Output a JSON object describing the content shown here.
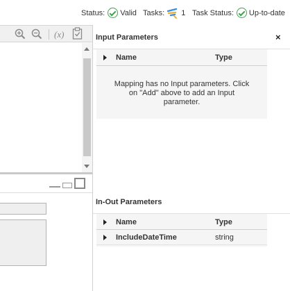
{
  "status_bar": {
    "status_label": "Status:",
    "status_value": "Valid",
    "tasks_label": "Tasks:",
    "tasks_count": "1",
    "task_status_label": "Task Status:",
    "task_status_value": "Up-to-date",
    "check_color": "#3fa34d"
  },
  "toolbar": {
    "zoom_in_icon": "zoom-in-icon",
    "zoom_out_icon": "zoom-out-icon",
    "expression_label": "(x)",
    "validate_icon": "clipboard-check-icon"
  },
  "input_parameters": {
    "title": "Input Parameters",
    "close_label": "×",
    "columns": [
      "Name",
      "Type"
    ],
    "empty_message": "Mapping has no Input parameters. Click on \"Add\" above to add an Input parameter."
  },
  "inout_parameters": {
    "title": "In-Out Parameters",
    "columns": [
      "Name",
      "Type"
    ],
    "rows": [
      {
        "name": "IncludeDateTime",
        "type": "string"
      }
    ]
  }
}
